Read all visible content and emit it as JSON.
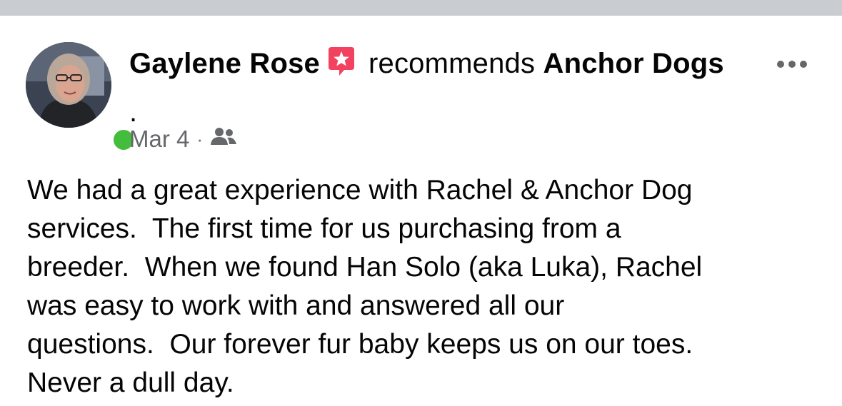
{
  "post": {
    "author": "Gaylene Rose",
    "verb": "recommends",
    "page_name": "Anchor Dogs",
    "page_suffix": " .",
    "date": "Mar 4",
    "separator": "·",
    "audience_icon": "friends-icon",
    "recommendation_icon": "recommendation-star-icon",
    "body": "We had a great experience with Rachel & Anchor Dog\nservices.  The first time for us purchasing from a\nbreeder.  When we found Han Solo (aka Luka), Rachel\nwas easy to work with and answered all our\nquestions.  Our forever fur baby keeps us on our toes.\nNever a dull day."
  },
  "colors": {
    "recommend_red": "#f3425f",
    "online_green": "#45bd3c",
    "secondary_text": "#65676b",
    "top_band": "#c9ccd1"
  }
}
